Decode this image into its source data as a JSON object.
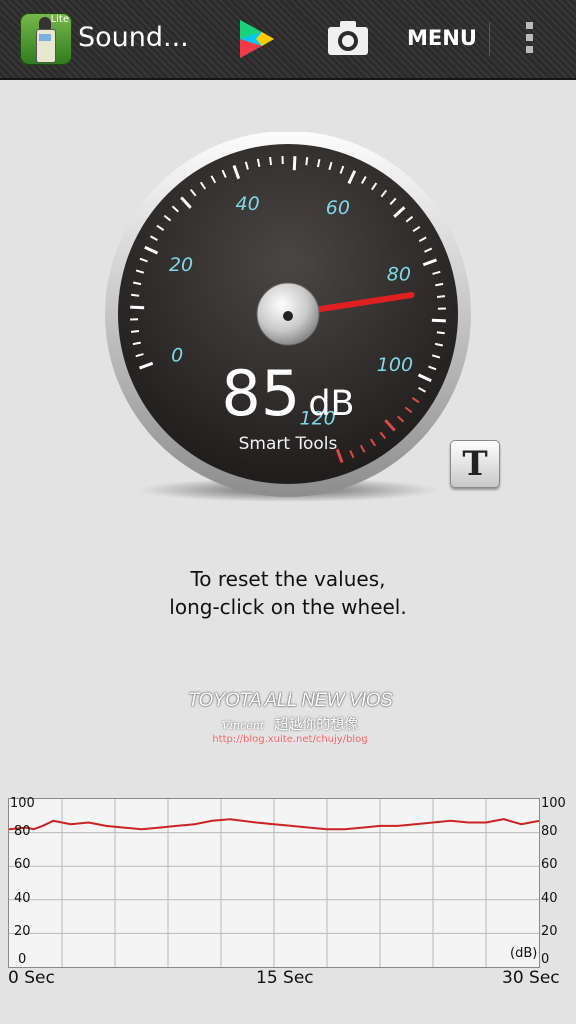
{
  "action_bar": {
    "app_icon": "sound-meter-lite-app-icon",
    "app_icon_badge": "Lite",
    "title": "Sound...",
    "play_store_icon": "google-play-icon",
    "camera_icon": "camera-icon",
    "menu_label": "MENU",
    "overflow_icon": "overflow-menu-icon"
  },
  "gauge": {
    "value": 85,
    "unit": "dB",
    "scale_labels": [
      "0",
      "20",
      "40",
      "60",
      "80",
      "100",
      "120"
    ],
    "brand": "Smart Tools",
    "colors": {
      "label": "#7fd8e8",
      "needle": "#e02020",
      "redzone": "#e04848"
    }
  },
  "t_button_label": "T",
  "hint": {
    "line1": "To reset the values,",
    "line2": "long-click on the wheel."
  },
  "watermark": {
    "title": "TOYOTA ALL NEW VIOS",
    "signature": "Vincent",
    "slogan": "超越你的想像",
    "url": "http://blog.xuite.net/chujy/blog"
  },
  "chart_data": {
    "type": "line",
    "title": "",
    "xlabel": "",
    "ylabel": "(dB)",
    "x_ticks": [
      "0 Sec",
      "15 Sec",
      "30 Sec"
    ],
    "y_ticks": [
      "0",
      "20",
      "40",
      "60",
      "80",
      "100"
    ],
    "xlim": [
      0,
      30
    ],
    "ylim": [
      0,
      100
    ],
    "grid": true,
    "color": "#cc2222",
    "series": [
      {
        "x": [
          0,
          1,
          1.4,
          1.9,
          2.5,
          3.5,
          4.5,
          5.5,
          6.5,
          7.5,
          8.5,
          9.5,
          10.5,
          11.5,
          12.5,
          13.2,
          14,
          15,
          16,
          17,
          18,
          19,
          20,
          21,
          22,
          23,
          24,
          25,
          26,
          27,
          28,
          29,
          30
        ],
        "values": [
          82,
          83,
          82,
          84,
          87,
          85,
          86,
          84,
          83,
          82,
          83,
          84,
          85,
          87,
          88,
          87,
          86,
          85,
          84,
          83,
          82,
          82,
          83,
          84,
          84,
          85,
          86,
          87,
          86,
          86,
          88,
          85,
          87
        ]
      }
    ]
  }
}
